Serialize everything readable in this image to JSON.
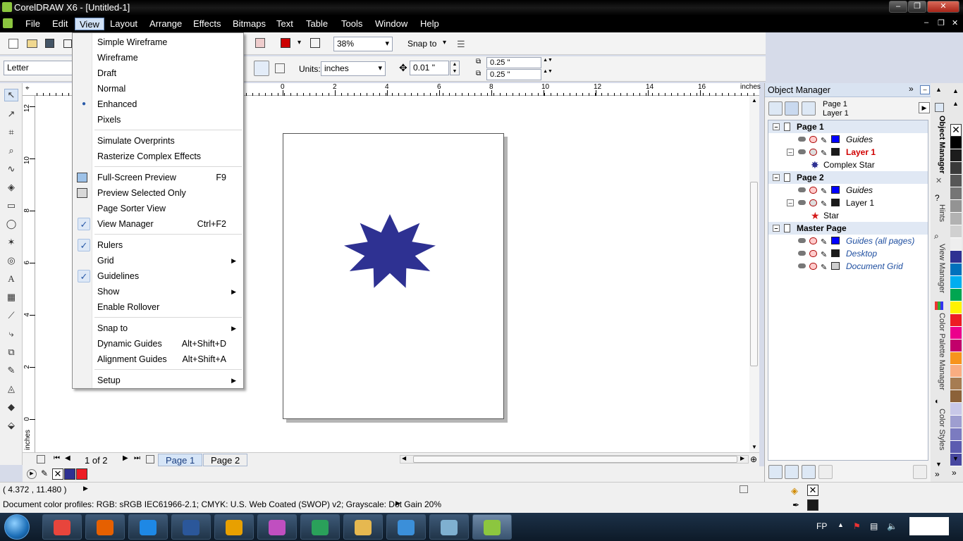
{
  "window": {
    "title": "CorelDRAW X6 - [Untitled-1]"
  },
  "menubar": {
    "items": [
      "File",
      "Edit",
      "View",
      "Layout",
      "Arrange",
      "Effects",
      "Bitmaps",
      "Text",
      "Table",
      "Tools",
      "Window",
      "Help"
    ]
  },
  "standard_bar": {
    "zoom": "38%",
    "snap_to": "Snap to"
  },
  "property_bar": {
    "paper_size": "Letter",
    "units_label": "Units:",
    "units": "inches",
    "nudge": "0.01 \"",
    "dup_x": "0.25 \"",
    "dup_y": "0.25 \""
  },
  "rulers": {
    "unit": "inches",
    "h_ticks": [
      "0",
      "2",
      "4",
      "6",
      "8",
      "10",
      "12",
      "14",
      "16"
    ],
    "v_ticks": [
      "12",
      "10",
      "8",
      "6",
      "4",
      "2",
      "0"
    ],
    "v_unit": "inches"
  },
  "view_menu": {
    "items": [
      {
        "label": "Simple Wireframe",
        "shortcut": "",
        "submenu": false,
        "check": "",
        "icon": ""
      },
      {
        "label": "Wireframe",
        "shortcut": "",
        "submenu": false,
        "check": "",
        "icon": ""
      },
      {
        "label": "Draft",
        "shortcut": "",
        "submenu": false,
        "check": "",
        "icon": ""
      },
      {
        "label": "Normal",
        "shortcut": "",
        "submenu": false,
        "check": "",
        "icon": ""
      },
      {
        "label": "Enhanced",
        "shortcut": "",
        "submenu": false,
        "check": "radio",
        "icon": ""
      },
      {
        "label": "Pixels",
        "shortcut": "",
        "submenu": false,
        "check": "",
        "icon": ""
      },
      {
        "sep": true
      },
      {
        "label": "Simulate Overprints",
        "shortcut": "",
        "submenu": false,
        "check": "",
        "icon": ""
      },
      {
        "label": "Rasterize Complex Effects",
        "shortcut": "",
        "submenu": false,
        "check": "",
        "icon": ""
      },
      {
        "sep": true
      },
      {
        "label": "Full-Screen Preview",
        "shortcut": "F9",
        "submenu": false,
        "check": "",
        "icon": "fullscreen-icon"
      },
      {
        "label": "Preview Selected Only",
        "shortcut": "",
        "submenu": false,
        "check": "",
        "icon": "preview-selected-icon"
      },
      {
        "label": "Page Sorter View",
        "shortcut": "",
        "submenu": false,
        "check": "",
        "icon": ""
      },
      {
        "label": "View Manager",
        "shortcut": "Ctrl+F2",
        "submenu": false,
        "check": "check",
        "icon": ""
      },
      {
        "sep": true
      },
      {
        "label": "Rulers",
        "shortcut": "",
        "submenu": false,
        "check": "check",
        "icon": ""
      },
      {
        "label": "Grid",
        "shortcut": "",
        "submenu": true,
        "check": "",
        "icon": ""
      },
      {
        "label": "Guidelines",
        "shortcut": "",
        "submenu": false,
        "check": "check",
        "icon": ""
      },
      {
        "label": "Show",
        "shortcut": "",
        "submenu": true,
        "check": "",
        "icon": ""
      },
      {
        "label": "Enable Rollover",
        "shortcut": "",
        "submenu": false,
        "check": "",
        "icon": ""
      },
      {
        "sep": true
      },
      {
        "label": "Snap to",
        "shortcut": "",
        "submenu": true,
        "check": "",
        "icon": ""
      },
      {
        "label": "Dynamic Guides",
        "shortcut": "Alt+Shift+D",
        "submenu": false,
        "check": "",
        "icon": ""
      },
      {
        "label": "Alignment Guides",
        "shortcut": "Alt+Shift+A",
        "submenu": false,
        "check": "",
        "icon": ""
      },
      {
        "sep": true
      },
      {
        "label": "Setup",
        "shortcut": "",
        "submenu": true,
        "check": "",
        "icon": ""
      }
    ]
  },
  "page_nav": {
    "counter": "1 of 2",
    "tabs": [
      "Page 1",
      "Page 2"
    ],
    "active": 0
  },
  "object_manager": {
    "title": "Object Manager",
    "current_page": "Page 1",
    "current_layer": "Layer 1",
    "rows": [
      {
        "type": "page",
        "label": "Page 1"
      },
      {
        "type": "layer",
        "label": "Guides",
        "color": "#0000ff",
        "style": "italic"
      },
      {
        "type": "layer",
        "label": "Layer 1",
        "color": "#1a1a1a",
        "style": "active",
        "expandable": true
      },
      {
        "type": "object",
        "label": "Complex Star",
        "icon": "complex-star-icon"
      },
      {
        "type": "page",
        "label": "Page 2"
      },
      {
        "type": "layer",
        "label": "Guides",
        "color": "#0000ff",
        "style": "italic"
      },
      {
        "type": "layer",
        "label": "Layer 1",
        "color": "#1a1a1a",
        "style": "normal",
        "expandable": true
      },
      {
        "type": "object",
        "label": "Star",
        "icon": "star-icon"
      },
      {
        "type": "page",
        "label": "Master Page"
      },
      {
        "type": "layer",
        "label": "Guides (all pages)",
        "color": "#0000ff",
        "style": "master"
      },
      {
        "type": "layer",
        "label": "Desktop",
        "color": "#1a1a1a",
        "style": "master"
      },
      {
        "type": "layer",
        "label": "Document Grid",
        "color": "#cfcfcf",
        "style": "master"
      }
    ]
  },
  "docker_tabs": [
    "Object Manager",
    "Hints",
    "View Manager",
    "Color Palette Manager",
    "Color Styles"
  ],
  "status": {
    "coords": "( 4.372 , 11.480 )",
    "profiles": "Document color profiles: RGB: sRGB IEC61966-2.1; CMYK: U.S. Web Coated (SWOP) v2; Grayscale: Dot Gain 20%"
  },
  "palette_colors": [
    "#ffffff",
    "#000000",
    "#1c1c1c",
    "#3a3a3a",
    "#575757",
    "#757575",
    "#939393",
    "#b2b2b2",
    "#d0d0d0",
    "#eeeeee",
    "#2e3192",
    "#0071bc",
    "#00aeef",
    "#00a651",
    "#fff200",
    "#ed1c24",
    "#ec008c",
    "#c2006b",
    "#f7941d",
    "#f9ad81",
    "#a67c52",
    "#8c6239",
    "#c8c8e8",
    "#9e9ed0",
    "#7b7bc0",
    "#5b5bb0",
    "#4848a0"
  ],
  "doc_palette": [
    "#2e3192",
    "#ed1c24"
  ],
  "taskbar": {
    "language": "FP",
    "apps": [
      "chrome-icon",
      "firefox-icon",
      "ie-icon",
      "word-icon",
      "outlook-icon",
      "paint-icon",
      "messenger-icon",
      "explorer-icon",
      "media-icon",
      "notepad-icon",
      "coreldraw-icon"
    ]
  },
  "colors": {
    "star": "#2e3192",
    "accent": "#cfe0f5"
  }
}
